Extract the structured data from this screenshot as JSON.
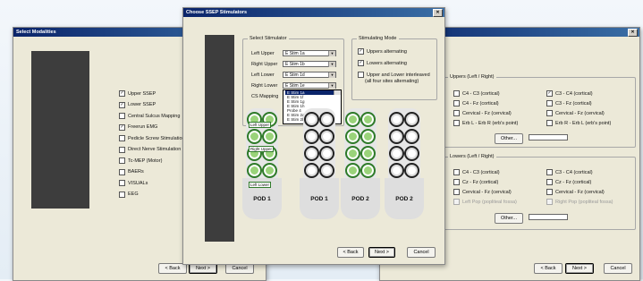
{
  "left_window": {
    "title": "Select Modalities",
    "modalities": [
      {
        "label": "Upper SSEP",
        "checked": true
      },
      {
        "label": "Lower SSEP",
        "checked": true
      },
      {
        "label": "Central Sulcus Mapping",
        "checked": false
      },
      {
        "label": "Freerun EMG",
        "checked": true
      },
      {
        "label": "Pedicle Screw Stimulation",
        "checked": false
      },
      {
        "label": "Direct Nerve Stimulation",
        "checked": false
      },
      {
        "label": "Tc-MEP (Motor)",
        "checked": false
      },
      {
        "label": "BAERs",
        "checked": false
      },
      {
        "label": "VISUALs",
        "checked": false
      },
      {
        "label": "EEG",
        "checked": false
      }
    ],
    "back": "< Back",
    "next": "Next >",
    "cancel": "Cancel"
  },
  "center_window": {
    "title": "Choose SSEP Stimulators",
    "select_group": "Select Stimulator",
    "stim_rows": [
      {
        "label": "Left Upper",
        "value": "E Stim 1a"
      },
      {
        "label": "Right Upper",
        "value": "E Stim 1b"
      },
      {
        "label": "Left Lower",
        "value": "E Stim 1d"
      },
      {
        "label": "Right Lower",
        "value": "E Stim 1e"
      },
      {
        "label": "CS Mapping",
        "value": ""
      }
    ],
    "dropdown_items": [
      "E Stim 1a",
      "E Stim 1f",
      "E Stim 1g",
      "E Stim 1h",
      "Probe 4",
      "E Stim 2a",
      "E Stim 2b"
    ],
    "mode_group": "Stimulating Mode",
    "modes": [
      {
        "label": "Uppers alternating",
        "checked": true
      },
      {
        "label": "Lowers alternating",
        "checked": true
      },
      {
        "label": "Upper and Lower interleaved",
        "checked": false
      }
    ],
    "mode_note": "(all four sites alternating)",
    "pod_tags": [
      "Left Upper",
      "Right Upper",
      "Left Lower"
    ],
    "pods": [
      "POD 1",
      "POD 1",
      "POD 2",
      "POD 2"
    ],
    "back": "< Back",
    "next": "Next >",
    "cancel": "Cancel"
  },
  "right_window": {
    "uppers_group": "Uppers (Left / Right)",
    "uppers": [
      [
        "C4 - C3 (cortical)",
        "C3 - C4 (cortical)"
      ],
      [
        "C4 - Fz (cortical)",
        "C3 - Fz (cortical)"
      ],
      [
        "Cervical - Fz (cervical)",
        "Cervical - Fz (cervical)"
      ],
      [
        "Erb L - Erb R (erb's point)",
        "Erb R - Erb L (erb's point)"
      ]
    ],
    "lowers_group": "Lowers (Left / Right)",
    "lowers": [
      [
        "C4 - C3 (cortical)",
        "C3 - C4 (cortical)"
      ],
      [
        "Cz - Fz (cortical)",
        "Cz - Fz (cortical)"
      ],
      [
        "Cervical - Fz (cervical)",
        "Cervical - Fz (cervical)"
      ],
      [
        "Left Pop (popliteal fossa)",
        "Right Pop (popliteal fossa)"
      ]
    ],
    "other": "Other...",
    "back": "< Back",
    "next": "Next >",
    "cancel": "Cancel"
  }
}
